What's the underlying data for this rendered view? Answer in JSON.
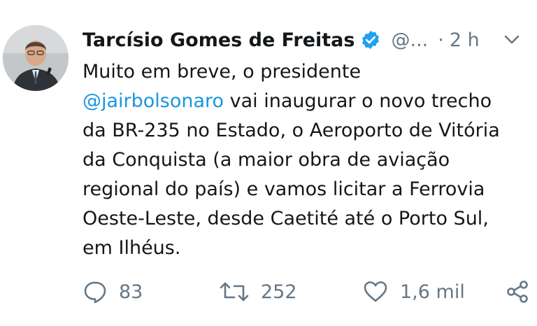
{
  "tweet": {
    "author": {
      "name": "Tarcísio Gomes de Freitas",
      "handle": "@...",
      "separator": "·",
      "time": "2 h"
    },
    "body": {
      "line1": "Muito em breve, o presidente",
      "mention": "@jairbolsonaro",
      "line2_rest": " vai inaugurar o novo trecho",
      "line3": "da BR-235 no Estado, o Aeroporto de Vitória",
      "line4": "da Conquista (a maior obra de aviação",
      "line5": "regional do país) e vamos licitar a Ferrovia",
      "line6": "Oeste-Leste, desde Caetité até o Porto Sul,",
      "line7": "em Ilhéus."
    },
    "stats": {
      "replies": "83",
      "retweets": "252",
      "likes": "1,6 mil"
    }
  },
  "colors": {
    "link": "#1b95e0",
    "secondary": "#657786",
    "text": "#14171a",
    "verified": "#1da1f2"
  },
  "icons": [
    "reply-icon",
    "retweet-icon",
    "like-icon",
    "share-icon",
    "verified-badge-icon",
    "chevron-down-icon"
  ]
}
